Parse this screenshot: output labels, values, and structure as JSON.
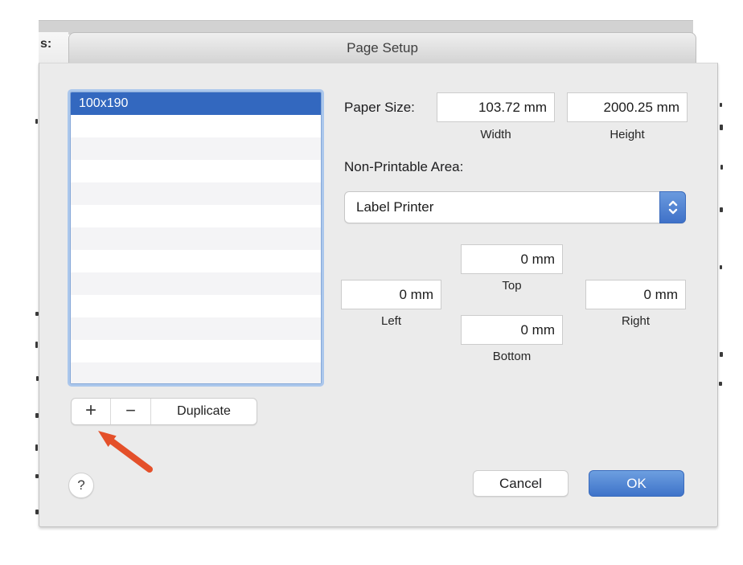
{
  "window": {
    "title": "Page Setup",
    "background_fragment": "s:"
  },
  "list": {
    "items": [
      {
        "label": "100x190",
        "selected": true
      }
    ]
  },
  "paper_size": {
    "label": "Paper Size:",
    "width": {
      "value": "103.72 mm",
      "label": "Width"
    },
    "height": {
      "value": "2000.25 mm",
      "label": "Height"
    }
  },
  "non_printable_area": {
    "label": "Non-Printable Area:",
    "selected_option": "Label Printer"
  },
  "margins": {
    "top": {
      "value": "0 mm",
      "label": "Top"
    },
    "left": {
      "value": "0 mm",
      "label": "Left"
    },
    "right": {
      "value": "0 mm",
      "label": "Right"
    },
    "bottom": {
      "value": "0 mm",
      "label": "Bottom"
    }
  },
  "actions": {
    "add": "+",
    "remove": "−",
    "duplicate": "Duplicate"
  },
  "footer": {
    "help": "?",
    "cancel": "Cancel",
    "ok": "OK"
  },
  "colors": {
    "selection_blue": "#3368bf",
    "accent_blue": "#4a7fd1",
    "focus_ring": "#abc7ec",
    "annotation_arrow": "#e4502a"
  }
}
